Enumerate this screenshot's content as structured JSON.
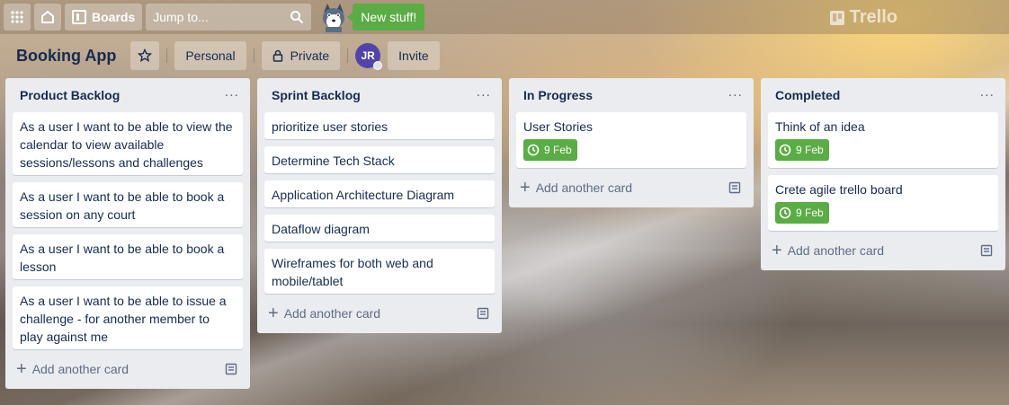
{
  "topbar": {
    "boards_label": "Boards",
    "search_placeholder": "Jump to...",
    "new_stuff_label": "New stuff!",
    "logo_text": "Trello"
  },
  "board": {
    "title": "Booking App",
    "visibility_team": "Personal",
    "visibility_privacy": "Private",
    "member_initials": "JR",
    "invite_label": "Invite"
  },
  "lists": [
    {
      "title": "Product Backlog",
      "cards": [
        {
          "text": "As a user I want to be able to view the calendar to view available sessions/lessons and challenges"
        },
        {
          "text": "As a user I want to be able to book a session on any court"
        },
        {
          "text": "As a user I want to be able to book a lesson"
        },
        {
          "text": "As a user I want to be able to issue a challenge - for another member to play against me"
        }
      ],
      "add_label": "Add another card"
    },
    {
      "title": "Sprint Backlog",
      "cards": [
        {
          "text": "prioritize user stories"
        },
        {
          "text": "Determine Tech Stack"
        },
        {
          "text": "Application Architecture Diagram"
        },
        {
          "text": "Dataflow diagram"
        },
        {
          "text": "Wireframes for both web and mobile/tablet"
        }
      ],
      "add_label": "Add another card"
    },
    {
      "title": "In Progress",
      "cards": [
        {
          "text": "User Stories",
          "due": "9 Feb"
        }
      ],
      "add_label": "Add another card"
    },
    {
      "title": "Completed",
      "cards": [
        {
          "text": "Think of an idea",
          "due": "9 Feb"
        },
        {
          "text": "Crete agile trello board",
          "due": "9 Feb"
        }
      ],
      "add_label": "Add another card"
    }
  ],
  "colors": {
    "due_badge": "#5aac44",
    "list_bg": "#ebecf0",
    "avatar": "#5243aa"
  }
}
